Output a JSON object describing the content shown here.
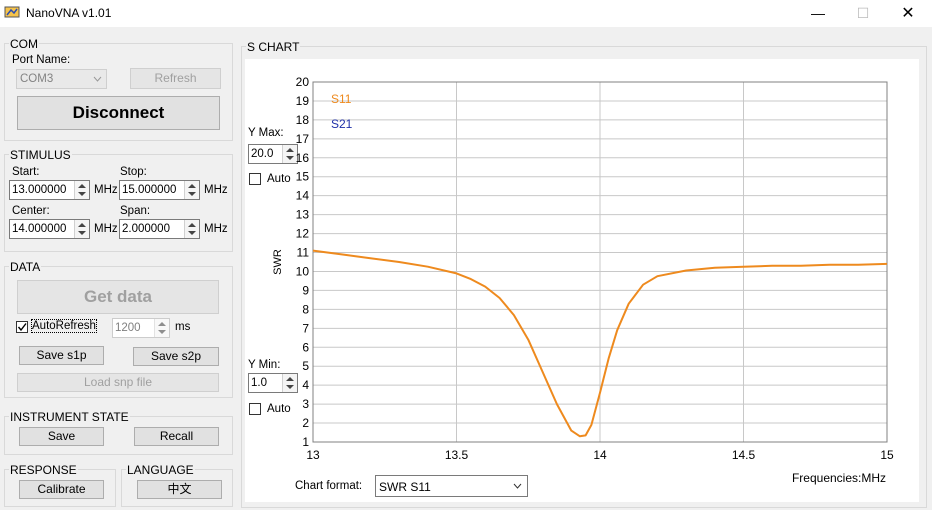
{
  "window": {
    "title": "NanoVNA v1.01",
    "minimize_glyph": "—",
    "maximize_glyph": "☐",
    "close_glyph": "✕"
  },
  "com": {
    "legend": "COM",
    "port_label": "Port Name:",
    "port_value": "COM3",
    "refresh_label": "Refresh",
    "disconnect_label": "Disconnect"
  },
  "stimulus": {
    "legend": "STIMULUS",
    "start_label": "Start:",
    "start_value": "13.000000",
    "start_unit": "MHz",
    "stop_label": "Stop:",
    "stop_value": "15.000000",
    "stop_unit": "MHz",
    "center_label": "Center:",
    "center_value": "14.000000",
    "center_unit": "MHz",
    "span_label": "Span:",
    "span_value": "2.000000",
    "span_unit": "MHz"
  },
  "data": {
    "legend": "DATA",
    "get_data_label": "Get data",
    "autorefresh_label": "AutoRefresh",
    "autorefresh_checked": true,
    "interval_value": "1200",
    "interval_unit": "ms",
    "save_s1p_label": "Save s1p",
    "save_s2p_label": "Save s2p",
    "load_snp_label": "Load snp file"
  },
  "instrument": {
    "legend": "INSTRUMENT STATE",
    "save_label": "Save",
    "recall_label": "Recall"
  },
  "response": {
    "legend": "RESPONSE",
    "calibrate_label": "Calibrate"
  },
  "language": {
    "legend": "LANGUAGE",
    "value": "中文"
  },
  "schart": {
    "legend": "S CHART",
    "ymax_label": "Y Max:",
    "ymax_value": "20.0",
    "ymax_auto_label": "Auto",
    "ymin_label": "Y Min:",
    "ymin_value": "1.0",
    "ymin_auto_label": "Auto",
    "format_label": "Chart format:",
    "format_value": "SWR S11"
  },
  "chart_data": {
    "type": "line",
    "ylabel": "SWR",
    "xlabel": "Frequencies:MHz",
    "xlim": [
      13,
      15
    ],
    "ylim": [
      1,
      20
    ],
    "xticks": [
      13,
      13.5,
      14,
      14.5,
      15
    ],
    "xtick_labels": [
      "13",
      "13.5",
      "14",
      "14.5",
      "15"
    ],
    "yticks": [
      1,
      2,
      3,
      4,
      5,
      6,
      7,
      8,
      9,
      10,
      11,
      12,
      13,
      14,
      15,
      16,
      17,
      18,
      19,
      20
    ],
    "grid": true,
    "legend_placement": "top-left",
    "series": [
      {
        "name": "S11",
        "color": "#ee8a1e",
        "x": [
          13.0,
          13.1,
          13.2,
          13.3,
          13.4,
          13.5,
          13.55,
          13.6,
          13.65,
          13.7,
          13.75,
          13.8,
          13.85,
          13.9,
          13.93,
          13.95,
          13.97,
          14.0,
          14.03,
          14.06,
          14.1,
          14.15,
          14.2,
          14.3,
          14.4,
          14.5,
          14.6,
          14.7,
          14.8,
          14.9,
          15.0
        ],
        "y": [
          11.1,
          10.9,
          10.7,
          10.5,
          10.25,
          9.9,
          9.6,
          9.2,
          8.6,
          7.7,
          6.4,
          4.7,
          3.0,
          1.6,
          1.3,
          1.35,
          1.9,
          3.6,
          5.4,
          6.9,
          8.3,
          9.3,
          9.75,
          10.05,
          10.2,
          10.25,
          10.3,
          10.3,
          10.35,
          10.35,
          10.4
        ]
      },
      {
        "name": "S21",
        "color": "#1f2fa8",
        "x": [],
        "y": []
      }
    ]
  }
}
